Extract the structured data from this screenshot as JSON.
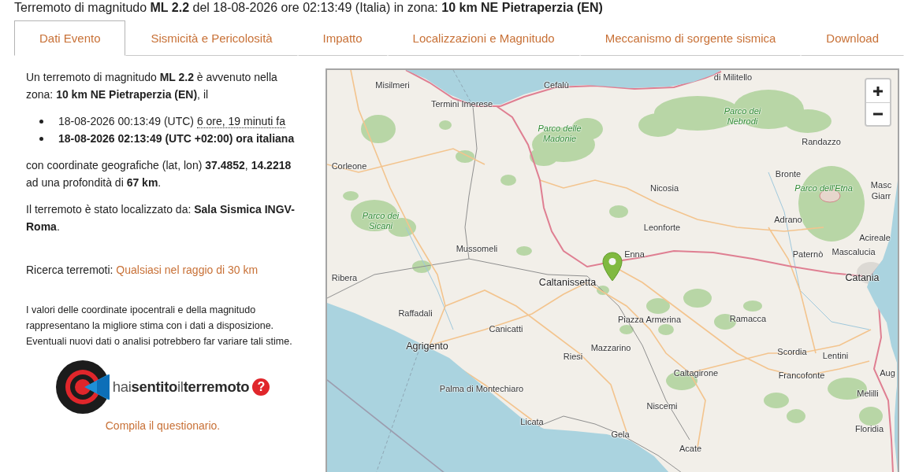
{
  "title": "Terremoto di magnitudo **ML 2.2** del 18-08-2026 ore 02:13:49 (Italia) in zona: **10 km NE Pietraperzia (EN)**",
  "tabs": [
    {
      "label": "Dati Evento",
      "selected": true
    },
    {
      "label": "Sismicità e Pericolosità",
      "selected": false
    },
    {
      "label": "Impatto",
      "selected": false
    },
    {
      "label": "Localizzazioni e Magnitudo",
      "selected": false
    },
    {
      "label": "Meccanismo di sorgente sismica",
      "selected": false
    },
    {
      "label": "Download",
      "selected": false
    }
  ],
  "details": {
    "summary": "Un terremoto di magnitudo **ML 2.2** è avvenuto nella zona: **10 km NE Pietraperzia (EN)**, il",
    "times": [
      {
        "kind": "utc",
        "text": "18-08-2026 00:13:49 (UTC)",
        "relative": "6 ore, 19 minuti fa"
      },
      {
        "kind": "local",
        "text": "18-08-2026 02:13:49 (UTC +02:00) ora italiana"
      }
    ],
    "coordinates": "con coordinate geografiche (lat, lon) **37.4852**, **14.2218** ad una profondità di **67 km**.",
    "located_by": "Il terremoto è stato localizzato da: **Sala Sismica INGV-Roma**.",
    "search": {
      "label": "Ricerca terremoti:",
      "link": "Qualsiasi nel raggio di 30 km"
    },
    "disclaimer": "I valori delle coordinate ipocentrali e della magnitudo rappresentano la migliore stima con i dati a disposizione. Eventuali nuovi dati o analisi potrebbero far variare tali stime.",
    "questionnaire": {
      "logo_text": "hai**sentito**il**terremoto**",
      "help_symbol": "?",
      "link": "Compila il questionario."
    }
  },
  "map": {
    "labels": [
      {
        "text": "di Militello",
        "kind": "town"
      },
      {
        "text": "Misilmeri",
        "kind": "town"
      },
      {
        "text": "Cefalù",
        "kind": "town"
      },
      {
        "text": "Termini Imerese",
        "kind": "town"
      },
      {
        "text": "Parco delle Madonie",
        "kind": "park"
      },
      {
        "text": "Parco dei Nebrodi",
        "kind": "park"
      },
      {
        "text": "Randazzo",
        "kind": "town"
      },
      {
        "text": "Corleone",
        "kind": "town"
      },
      {
        "text": "Bronte",
        "kind": "town"
      },
      {
        "text": "Nicosia",
        "kind": "town"
      },
      {
        "text": "Parco dell'Etna",
        "kind": "park"
      },
      {
        "text": "Masc",
        "kind": "town"
      },
      {
        "text": "Giarr",
        "kind": "town"
      },
      {
        "text": "Parco dei Sicani",
        "kind": "park"
      },
      {
        "text": "Leonforte",
        "kind": "town"
      },
      {
        "text": "Adrano",
        "kind": "town"
      },
      {
        "text": "Acireale",
        "kind": "town"
      },
      {
        "text": "Mussomeli",
        "kind": "town"
      },
      {
        "text": "Enna",
        "kind": "town"
      },
      {
        "text": "Paternò",
        "kind": "town"
      },
      {
        "text": "Mascalucia",
        "kind": "town"
      },
      {
        "text": "Ribera",
        "kind": "town"
      },
      {
        "text": "Caltanissetta",
        "kind": "capital"
      },
      {
        "text": "Catania",
        "kind": "capital"
      },
      {
        "text": "Raffadali",
        "kind": "town"
      },
      {
        "text": "Piazza Armerina",
        "kind": "town"
      },
      {
        "text": "Ramacca",
        "kind": "town"
      },
      {
        "text": "Canicatti",
        "kind": "town"
      },
      {
        "text": "Agrigento",
        "kind": "capital"
      },
      {
        "text": "Mazzarino",
        "kind": "town"
      },
      {
        "text": "Riesi",
        "kind": "town"
      },
      {
        "text": "Scordia",
        "kind": "town"
      },
      {
        "text": "Lentini",
        "kind": "town"
      },
      {
        "text": "Caltagirone",
        "kind": "town"
      },
      {
        "text": "Francofonte",
        "kind": "town"
      },
      {
        "text": "Aug",
        "kind": "town"
      },
      {
        "text": "Palma di Montechiaro",
        "kind": "town"
      },
      {
        "text": "Melilli",
        "kind": "town"
      },
      {
        "text": "Niscemi",
        "kind": "town"
      },
      {
        "text": "Licata",
        "kind": "town"
      },
      {
        "text": "Floridia",
        "kind": "town"
      },
      {
        "text": "Gela",
        "kind": "town"
      },
      {
        "text": "Acate",
        "kind": "town"
      }
    ]
  }
}
